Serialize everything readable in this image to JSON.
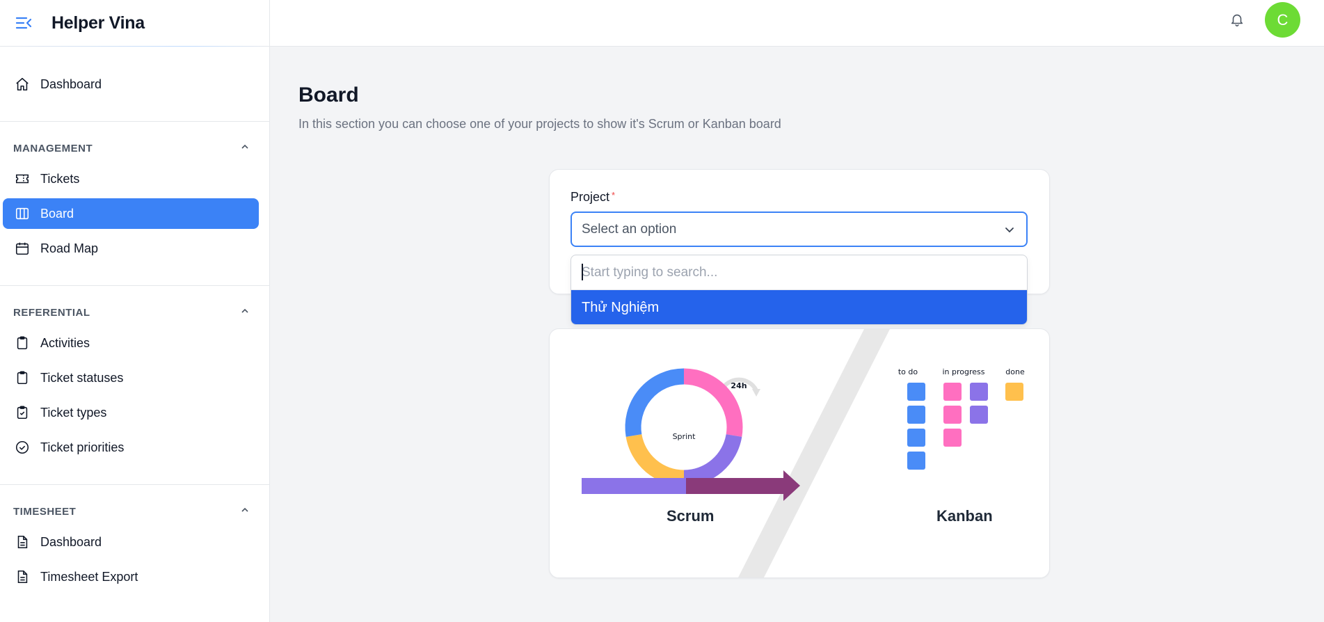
{
  "app": {
    "title": "Helper Vina"
  },
  "sidebar": {
    "dashboard": "Dashboard",
    "sections": [
      {
        "title": "MANAGEMENT",
        "items": [
          "Tickets",
          "Board",
          "Road Map"
        ]
      },
      {
        "title": "REFERENTIAL",
        "items": [
          "Activities",
          "Ticket statuses",
          "Ticket types",
          "Ticket priorities"
        ]
      },
      {
        "title": "TIMESHEET",
        "items": [
          "Dashboard",
          "Timesheet Export"
        ]
      }
    ]
  },
  "header": {
    "avatar_initial": "C"
  },
  "page": {
    "title": "Board",
    "description": "In this section you can choose one of your projects to show it's Scrum or Kanban board"
  },
  "form": {
    "project_label": "Project",
    "required_mark": "*",
    "select_placeholder": "Select an option",
    "search_placeholder": "Start typing to search...",
    "options": [
      "Thử Nghiệm"
    ]
  },
  "illustration": {
    "scrum_label": "Scrum",
    "kanban_label": "Kanban",
    "sprint_label": "Sprint",
    "cycle_label": "24h",
    "kanban_columns": [
      "to do",
      "in progress",
      "done"
    ]
  },
  "colors": {
    "accent": "#3b82f6",
    "option_highlight": "#2563eb",
    "avatar": "#6ddb35",
    "pink": "#ff6fc0",
    "purple": "#8b73e8",
    "yellow": "#ffc04d",
    "blue": "#4a8cf7",
    "arrow": "#8a3a7a"
  }
}
